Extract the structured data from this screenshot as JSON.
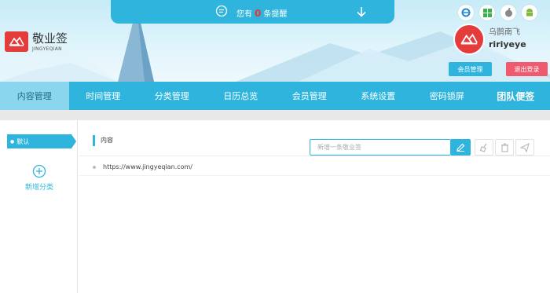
{
  "notice": {
    "prefix": "您有",
    "count": "0",
    "suffix": "条提醒"
  },
  "logo": {
    "name": "敬业签",
    "subtitle": "JINGYEQIAN"
  },
  "user": {
    "display_name": "乌鹊南飞",
    "username": "ririyeye",
    "member_button": "会员管理",
    "logout_button": "退出登录"
  },
  "platforms": [
    "ie-icon",
    "windows-icon",
    "apple-icon",
    "android-icon"
  ],
  "nav": {
    "items": [
      {
        "label": "内容管理"
      },
      {
        "label": "时间管理"
      },
      {
        "label": "分类管理"
      },
      {
        "label": "日历总览"
      },
      {
        "label": "会员管理"
      },
      {
        "label": "系统设置"
      },
      {
        "label": "密码锁屏"
      },
      {
        "label": "团队便签"
      }
    ],
    "active_index": 0
  },
  "sidebar": {
    "default_category": "默认",
    "add_category": "新增分类"
  },
  "main": {
    "title": "内容",
    "search_placeholder": "新增一条敬业签",
    "items": [
      {
        "text": "https://www.jingyeqian.com/"
      }
    ]
  },
  "colors": {
    "accent": "#2fb5dd",
    "brand_red": "#e43b3b",
    "logout": "#ef5a6e",
    "nav_active": "#8ad6ef"
  }
}
